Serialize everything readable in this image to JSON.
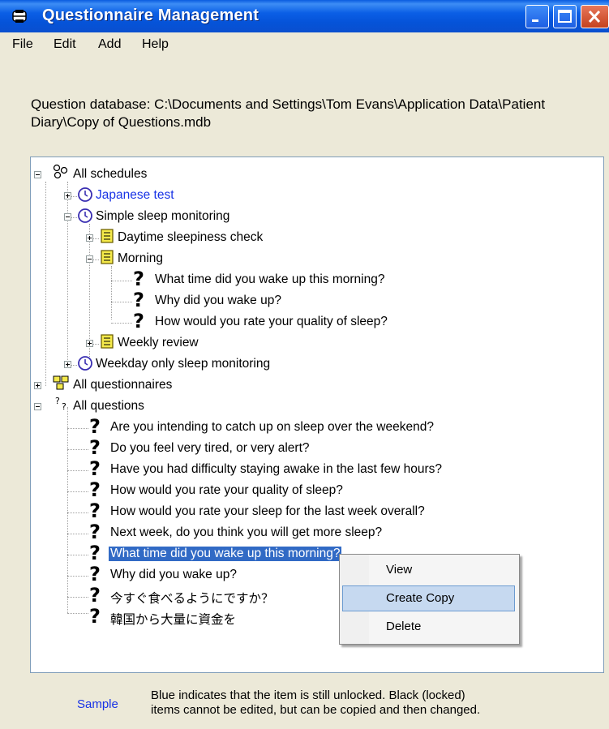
{
  "window": {
    "title": "Questionnaire Management",
    "icon": "app-icon",
    "controls": [
      "minimize-icon",
      "maximize-icon",
      "close-icon"
    ]
  },
  "menu": [
    "File",
    "Edit",
    "Add",
    "Help"
  ],
  "database_path": "Question database: C:\\Documents and Settings\\Tom Evans\\Application Data\\Patient Diary\\Copy of Questions.mdb",
  "tree": {
    "all_schedules": "All schedules",
    "japanese_test": "Japanese test",
    "simple_sleep": "Simple sleep monitoring",
    "daytime_check": "Daytime sleepiness check",
    "morning": "Morning",
    "morning_q1": "What time did you wake up this morning?",
    "morning_q2": "Why did you wake up?",
    "morning_q3": "How would you rate your quality of sleep?",
    "weekly_review": "Weekly review",
    "weekday_sleep": "Weekday only sleep monitoring",
    "all_questionnaires": "All questionnaires",
    "all_questions": "All questions",
    "questions": [
      "Are you intending to catch up on sleep over the weekend?",
      "Do you feel very tired, or very alert?",
      "Have you had difficulty staying awake in the last few hours?",
      "How would you rate your quality of sleep?",
      "How would you rate your sleep for the last week overall?",
      "Next week, do you think you will get more sleep?",
      "What time did you wake up this morning?",
      "Why did you wake up?",
      "今すぐ食べるようにですか？",
      "韓国から大量に資金を"
    ],
    "selected_index": 6
  },
  "context_menu": {
    "view": "View",
    "create_copy": "Create Copy",
    "delete": "Delete",
    "highlighted": "Create Copy"
  },
  "footer": {
    "sample": "Sample",
    "legend_line1": "Blue indicates that the item is still unlocked.  Black (locked)",
    "legend_line2": "items cannot be edited, but can be copied and then changed."
  },
  "colors": {
    "titlebar": "#0a5ce0",
    "unlocked_text": "#1833e6",
    "selection": "#316ac5",
    "window_bg": "#ece9d8"
  }
}
